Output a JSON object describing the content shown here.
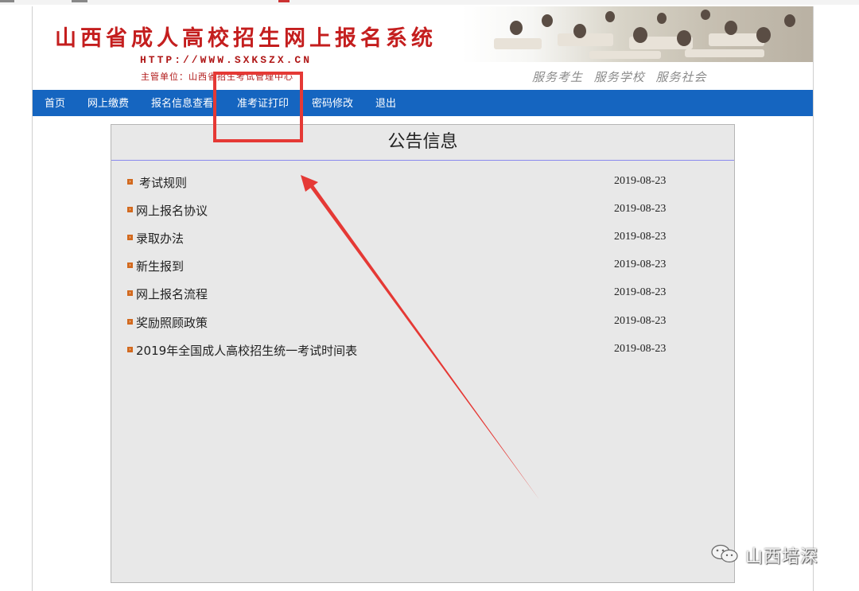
{
  "header": {
    "title": "山西省成人高校招生网上报名系统",
    "url": "HTTP://WWW.SXKSZX.CN",
    "sponsor": "主管单位：山西省招生考试管理中心",
    "slogan": "服务考生  服务学校  服务社会"
  },
  "nav": {
    "items": [
      {
        "label": "首页"
      },
      {
        "label": "网上缴费"
      },
      {
        "label": "报名信息查看"
      },
      {
        "label": "准考证打印"
      },
      {
        "label": "密码修改"
      },
      {
        "label": "退出"
      }
    ]
  },
  "notice": {
    "title": "公告信息",
    "items": [
      {
        "title": "考试规则",
        "date": "2019-08-23"
      },
      {
        "title": "网上报名协议",
        "date": "2019-08-23"
      },
      {
        "title": "录取办法",
        "date": "2019-08-23"
      },
      {
        "title": "新生报到",
        "date": "2019-08-23"
      },
      {
        "title": "网上报名流程",
        "date": "2019-08-23"
      },
      {
        "title": "奖励照顾政策",
        "date": "2019-08-23"
      },
      {
        "title": "2019年全国成人高校招生统一考试时间表",
        "date": "2019-08-23"
      }
    ]
  },
  "annotation": {
    "highlight_color": "#e53935"
  },
  "watermark": {
    "text": "山西培深",
    "icon": "wechat-icon"
  },
  "colors": {
    "nav_bg": "#1565c0",
    "title_red": "#c41e1e",
    "panel_bg": "#e8e8e8"
  }
}
